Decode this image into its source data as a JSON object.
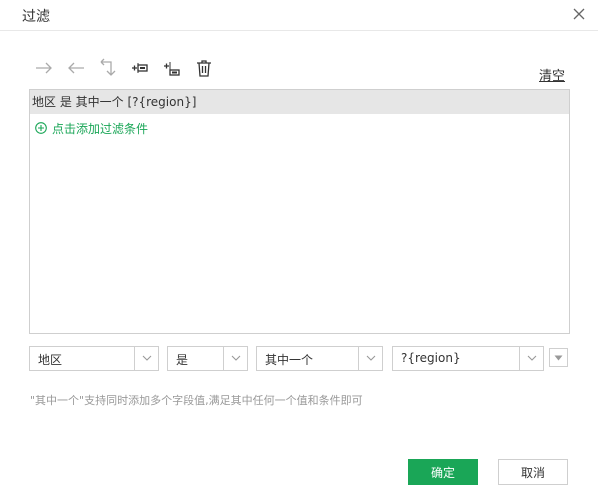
{
  "dialog": {
    "title": "过滤"
  },
  "toolbar": {
    "icons": [
      "arrow-right-icon",
      "arrow-left-icon",
      "back-return-icon",
      "add-condition-icon",
      "add-group-icon",
      "delete-icon"
    ],
    "clear_label": "清空"
  },
  "filter_list": {
    "rows": [
      {
        "text": "地区 是 其中一个 [?{region}]"
      }
    ],
    "add_label": "点击添加过滤条件"
  },
  "editor": {
    "field": "地区",
    "operator": "是",
    "match": "其中一个",
    "value": "?{region}"
  },
  "hint": "\"其中一个\"支持同时添加多个字段值,满足其中任何一个值和条件即可",
  "footer": {
    "ok_label": "确定",
    "cancel_label": "取消"
  },
  "colors": {
    "accent": "#1aa657",
    "selected_row": "#e6e6e6",
    "icon_disabled": "#aaaaaa",
    "icon_active": "#333333"
  }
}
